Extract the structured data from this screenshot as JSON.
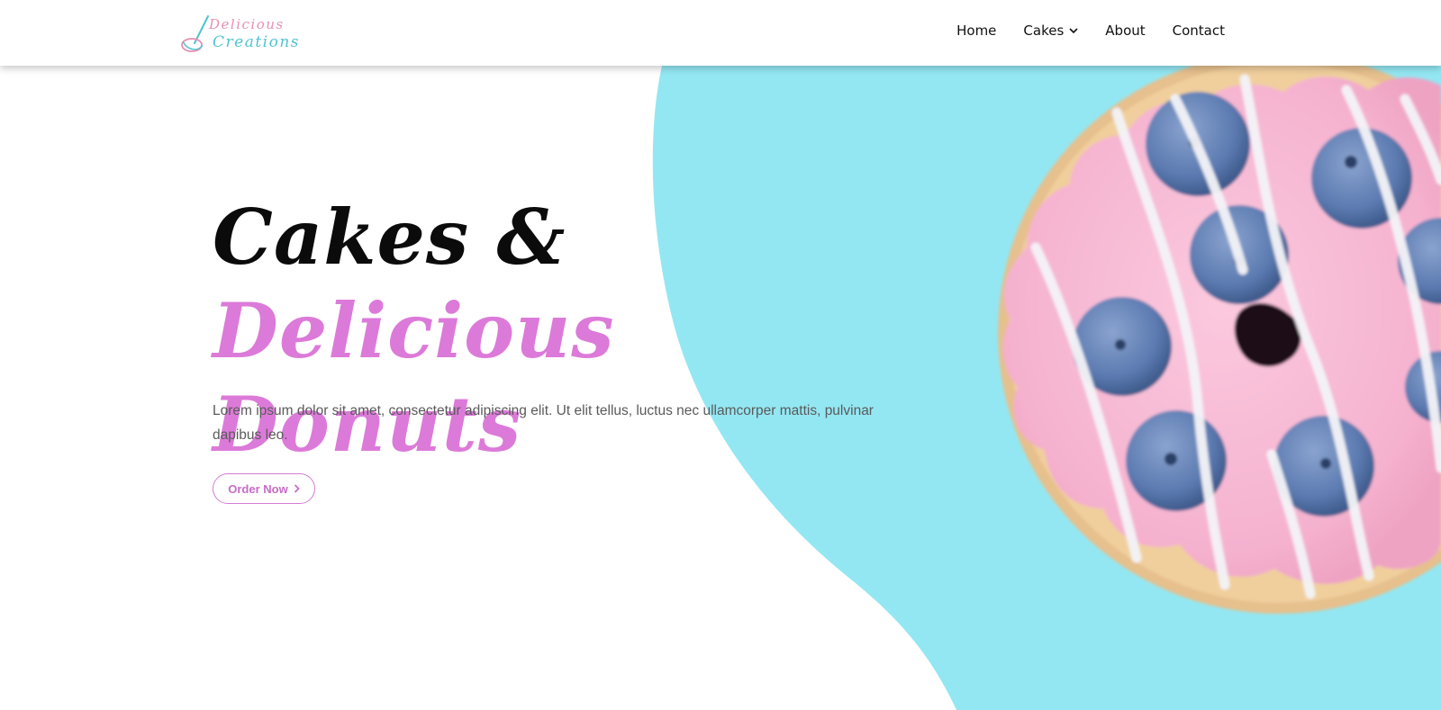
{
  "brand": {
    "logo_line1": "Delicious",
    "logo_line2": "Creations",
    "logo_color_pink": "#e88fb3",
    "logo_color_teal": "#4fc4cf"
  },
  "nav": {
    "items": [
      {
        "label": "Home"
      },
      {
        "label": "Cakes",
        "has_dropdown": true,
        "icon": "chevron-down-icon"
      },
      {
        "label": "About"
      },
      {
        "label": "Contact"
      }
    ]
  },
  "hero": {
    "title_part1": "Cakes & ",
    "title_part2": "Delicious",
    "title_part3": "Donuts",
    "description": "Lorem ipsum dolor sit amet, consectetur adipiscing elit. Ut elit tellus, luctus nec ullamcorper mattis, pulvinar dapibus leo.",
    "cta_label": "Order Now",
    "cta_icon": "chevron-right-icon",
    "image_subject": "pink frosted donut with blueberries"
  },
  "colors": {
    "accent_pink": "#dc7ad9",
    "teal_background": "#93e7f2",
    "frosting_pink": "#f6b8d2",
    "blueberry": "#5b7ab0",
    "text_dark": "#0b0b0b",
    "text_body": "#5a5a5a"
  }
}
